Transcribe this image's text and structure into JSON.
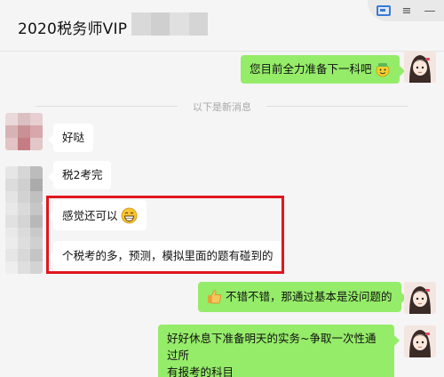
{
  "header": {
    "title": "2020税务师VIP"
  },
  "divider": {
    "text": "以下是新消息"
  },
  "messages": {
    "m1": "您目前全力准备下一科吧",
    "m2": "好哒",
    "m3": "税2考完",
    "m4": "感觉还可以",
    "m5": "个税考的多，预测，模拟里面的题有碰到的",
    "m6": "不错不错，那通过基本是没问题的",
    "m7_line1": "好好休息下准备明天的实务~争取一次性通过所",
    "m7_line2": "有报考的科目"
  },
  "icons": {
    "window": [
      "screen-share-icon",
      "menu-icon",
      "minimize-icon"
    ],
    "emojis": [
      "gift-face-emoji-icon",
      "grin-emoji-icon",
      "thumbs-up-icon"
    ]
  },
  "colors": {
    "sent_bubble": "#95ec69",
    "received_bubble": "#ffffff",
    "highlight_border": "#e0161f",
    "background": "#f5f5f5"
  }
}
